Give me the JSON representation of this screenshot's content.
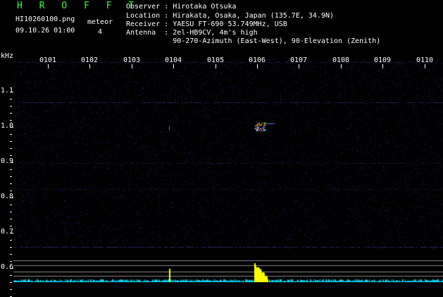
{
  "header": {
    "logo": "H R O F F T",
    "filename": "HI10260100.png",
    "datetime": "09.10.26 01:00",
    "meteor_label": "meteor",
    "meteor_count": "4",
    "observer_line": "Observer : Hirotaka Otsuka",
    "location_line": "Location : Hirakata, Osaka, Japan (135.7E, 34.9N)",
    "receiver_line": "Receiver : YAESU FT-690 53.749MHz, USB",
    "antenna_line": "Antenna  : 2el-HB9CV, 4m's high",
    "antenna_line2": "           90-270-Azimuth (East-West), 90-Elevation (Zenith)"
  },
  "axes": {
    "y_unit": "kHz",
    "time_ticks": [
      "0101",
      "0102",
      "0103",
      "0104",
      "0105",
      "0106",
      "0107",
      "0108",
      "0109",
      "0110"
    ],
    "freq_ticks": [
      "1.1",
      "1.0",
      "0.9",
      "0.8",
      "0.7",
      "0.6"
    ]
  },
  "colors": {
    "background": "#000000",
    "noise": "#1a1a5a",
    "logo": "#30ff30",
    "signal_low": "#00e0ff",
    "signal_high": "#ffff00"
  }
}
